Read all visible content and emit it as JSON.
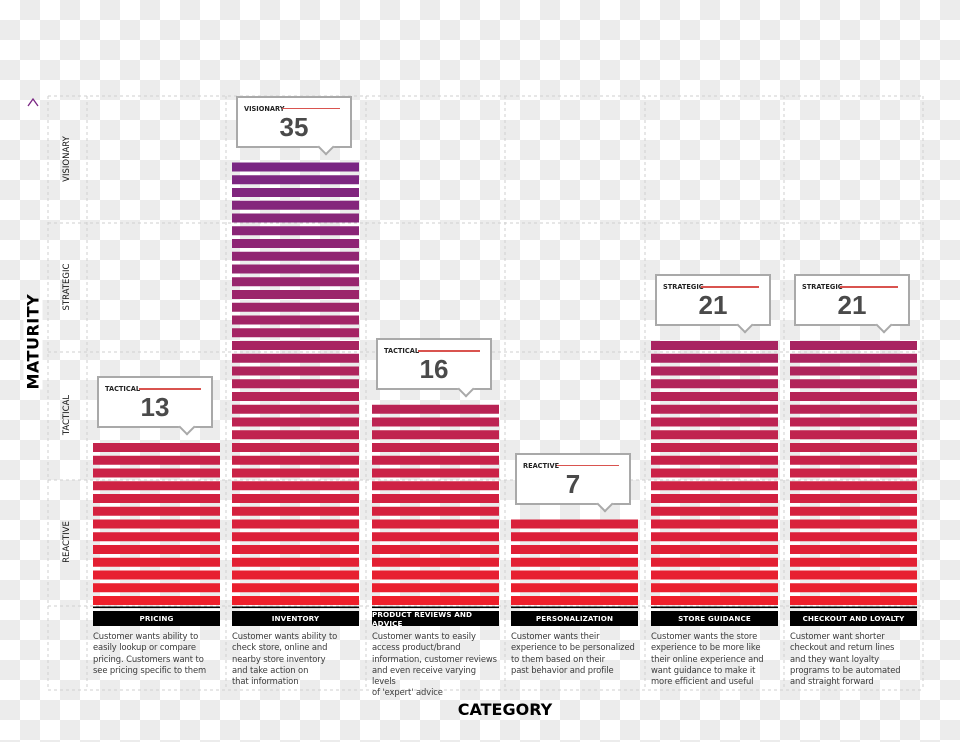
{
  "chart_data": {
    "type": "bar",
    "title": "",
    "xlabel": "CATEGORY",
    "ylabel": "MATURITY",
    "ylim": [
      0,
      40
    ],
    "maturity_levels": [
      "REACTIVE",
      "TACTICAL",
      "STRATEGIC",
      "VISIONARY"
    ],
    "categories": [
      "PRICING",
      "INVENTORY",
      "PRODUCT REVIEWS AND ADVICE",
      "PERSONALIZATION",
      "STORE GUIDANCE",
      "CHECKOUT AND LOYALTY"
    ],
    "values": [
      13,
      35,
      16,
      7,
      21,
      21
    ],
    "value_levels": [
      "TACTICAL",
      "VISIONARY",
      "TACTICAL",
      "REACTIVE",
      "STRATEGIC",
      "STRATEGIC"
    ],
    "descriptions": [
      [
        "Customer wants ability to",
        "easily lookup or compare",
        "pricing. Customers want to",
        "see pricing specific to them"
      ],
      [
        "Customer wants ability to",
        "check store, online and",
        "nearby store inventory",
        "and take action on",
        "that information"
      ],
      [
        "Customer wants to easily",
        "access product/brand",
        "information, customer reviews",
        "and even receive varying levels",
        "of 'expert' advice"
      ],
      [
        "Customer wants their",
        "experience to be personalized",
        "to them based on their",
        "past behavior and profile"
      ],
      [
        "Customer wants the store",
        "experience to be more like",
        "their online experience and",
        "want guidance to make it",
        "more efficient and useful"
      ],
      [
        "Customer want shorter",
        "checkout and return lines",
        "and they want loyalty",
        "programs to be automated",
        "and straight forward"
      ]
    ],
    "grid": true,
    "colors": {
      "low": "#ee1f2b",
      "mid": "#b2245a",
      "high": "#7a2683",
      "label_bg": "#000000",
      "callout_line": "#d9534f",
      "callout_border": "#a9a9a9"
    }
  }
}
